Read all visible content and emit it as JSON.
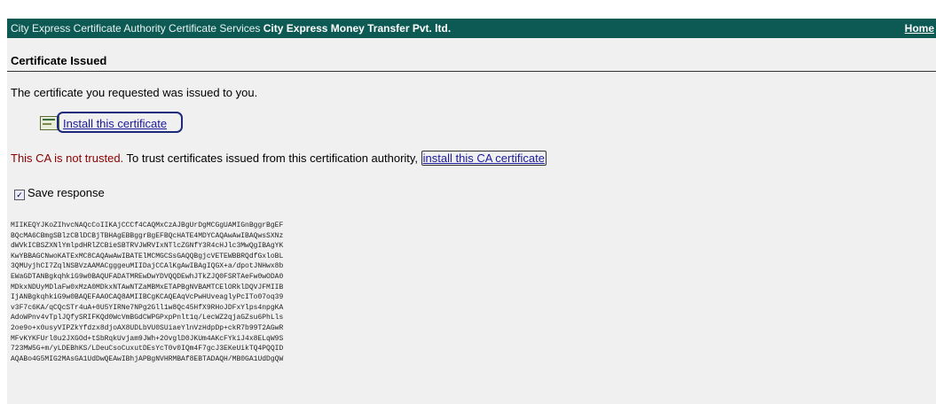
{
  "header": {
    "title_prefix": "City Express Certificate Authority Certificate Services ",
    "company": "City Express Money Transfer Pvt. ltd.",
    "home_link": "Home"
  },
  "main": {
    "section_title": "Certificate Issued",
    "message": "The certificate you requested was issued to you.",
    "install_link": "Install this certificate",
    "trust_warning": "This CA is not trusted.",
    "trust_text": " To trust certificates issued from this certification authority, ",
    "ca_link": "install this CA certificate",
    "save_response_label": "Save response",
    "save_response_checked": true,
    "pem_lines": [
      "MIIKEQYJKoZIhvcNAQcCoIIKAjCCCf4CAQMxCzAJBgUrDgMCGgUAMIGnBggrBgEF",
      "BQcMA6CBmgSBlzCBlDCBjTBHAgEBBggrBgEFBQcHATE4MDYCAQAwAwIBAQwsSXNz",
      "dWVkICBSZXNlYmlpdHRlZCBieSBTRVJWRVIxNTlcZGNfY3R4cHJlc3MwQgIBAgYK",
      "KwYBBAGCNwoKATExMC8CAQAwAwIBATElMCMGCSsGAQQBgjcVETEWBBRQdfGxloBL",
      "3QMUyjhCI7ZqlNSBVzAAMACgggeuMIIDajCCAlKgAwIBAgIQGX+a/dpotJNHwx8b",
      "EWaGDTANBgkqhkiG9w0BAQUFADATMREwDwYDVQQDEwhJTkZJQ0FSRTAeFw0wODA0",
      "MDkxNDUyMDlaFw0xMzA0MDkxNTAwNTZaMBMxETAPBgNVBAMTCElORklDQVJFMIIB",
      "IjANBgkqhkiG9w0BAQEFAAOCAQ8AMIIBCgKCAQEAqVcPwHUveaglyPcITo07oq39",
      "v3F7c6KA/qCQcSTr4uA+0U5YIRNe7NPg2Gll1w8Qc45HfX9RHoJDFxYlps4npgKA",
      "AdoWPnv4vTplJQfySRIFKQd0WcVmBGdCWPGPxpPnlt1q/LecWZ2qjaGZsu6PhLls",
      "2oe9o+x0usyVIPZkYfdzx8djoAX8UDLbVU0SUiaeYlnVzHdpDp+ckR7b99T2AGwR",
      "MFvKYKFUrl0u2JXGOd+tSbRqkUvjam9JWh+2OvglD0JKUm4AKcFYkiJ4x8ELqW9S",
      "723MW5G+m/yLDEBhKS/LDeuCsoCuxutDEsYcT0v0IQm4F7gcJ3EKeUikTQ4PQQID",
      "AQABo4G5MIG2MAsGA1UdDwQEAwIBhjAPBgNVHRMBAf8EBTADAQH/MB0GA1UdDgQW"
    ]
  }
}
